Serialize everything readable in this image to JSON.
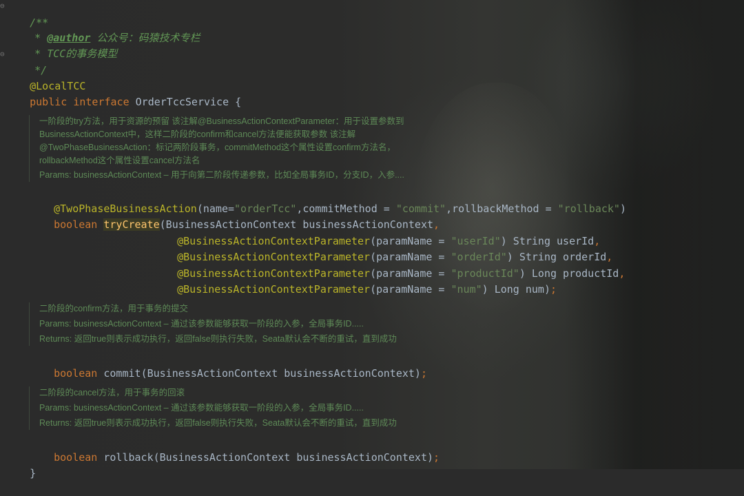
{
  "header_comment": {
    "open": "/**",
    "author_tag": "@author",
    "author_value": "公众号：码猿技术专栏",
    "desc": "TCC的事务模型",
    "close": "*/"
  },
  "class_decl": {
    "annotation": "@LocalTCC",
    "kw_public": "public",
    "kw_interface": "interface",
    "name": "OrderTccService",
    "open_brace": "{",
    "close_brace": "}"
  },
  "try_doc": {
    "lines": [
      "一阶段的try方法，用于资源的预留 该注解@BusinessActionContextParameter：用于设置参数到",
      "BusinessActionContext中，这样二阶段的confirm和cancel方法便能获取参数 该注解",
      "@TwoPhaseBusinessAction：标记两阶段事务，commitMethod这个属性设置confirm方法名，",
      "rollbackMethod这个属性设置cancel方法名",
      "Params: businessActionContext – 用于向第二阶段传递参数，比如全局事务ID，分支ID，入参...."
    ]
  },
  "try_method": {
    "annotation": "@TwoPhaseBusinessAction",
    "ann_open": "(name=",
    "name_val": "\"orderTcc\"",
    "commit_key": ",commitMethod = ",
    "commit_val": "\"commit\"",
    "rollback_key": ",rollbackMethod = ",
    "rollback_val": "\"rollback\"",
    "ann_close": ")",
    "return_type": "boolean",
    "method_name": "tryCreate",
    "first_param": "(BusinessActionContext businessActionContext",
    "comma": ",",
    "param_ann": "@BusinessActionContextParameter",
    "params": [
      {
        "key": "(paramName = ",
        "val": "\"userId\"",
        "rest": ") String userId",
        "end": ","
      },
      {
        "key": "(paramName = ",
        "val": "\"orderId\"",
        "rest": ") String orderId",
        "end": ","
      },
      {
        "key": "(paramName = ",
        "val": "\"productId\"",
        "rest": ") Long productId",
        "end": ","
      },
      {
        "key": "(paramName = ",
        "val": "\"num\"",
        "rest": ") Long num)",
        "end": ";"
      }
    ]
  },
  "commit_doc": {
    "lines": [
      "二阶段的confirm方法，用于事务的提交",
      "Params: businessActionContext – 通过该参数能够获取一阶段的入参，全局事务ID.....",
      "Returns: 返回true则表示成功执行，返回false则执行失败，Seata默认会不断的重试，直到成功"
    ]
  },
  "commit_method": {
    "return_type": "boolean",
    "name": "commit",
    "params": "(BusinessActionContext businessActionContext)",
    "end": ";"
  },
  "rollback_doc": {
    "lines": [
      "二阶段的cancel方法，用于事务的回滚",
      "Params: businessActionContext – 通过该参数能够获取一阶段的入参，全局事务ID.....",
      "Returns: 返回true则表示成功执行，返回false则执行失败，Seata默认会不断的重试，直到成功"
    ]
  },
  "rollback_method": {
    "return_type": "boolean",
    "name": "rollback",
    "params": "(BusinessActionContext businessActionContext)",
    "end": ";"
  },
  "colors": {
    "keyword": "#cc7832",
    "annotation": "#bbb529",
    "doc_comment": "#629755",
    "string": "#6a8759",
    "identifier": "#a9b7c6",
    "method_decl": "#ffc66d"
  }
}
